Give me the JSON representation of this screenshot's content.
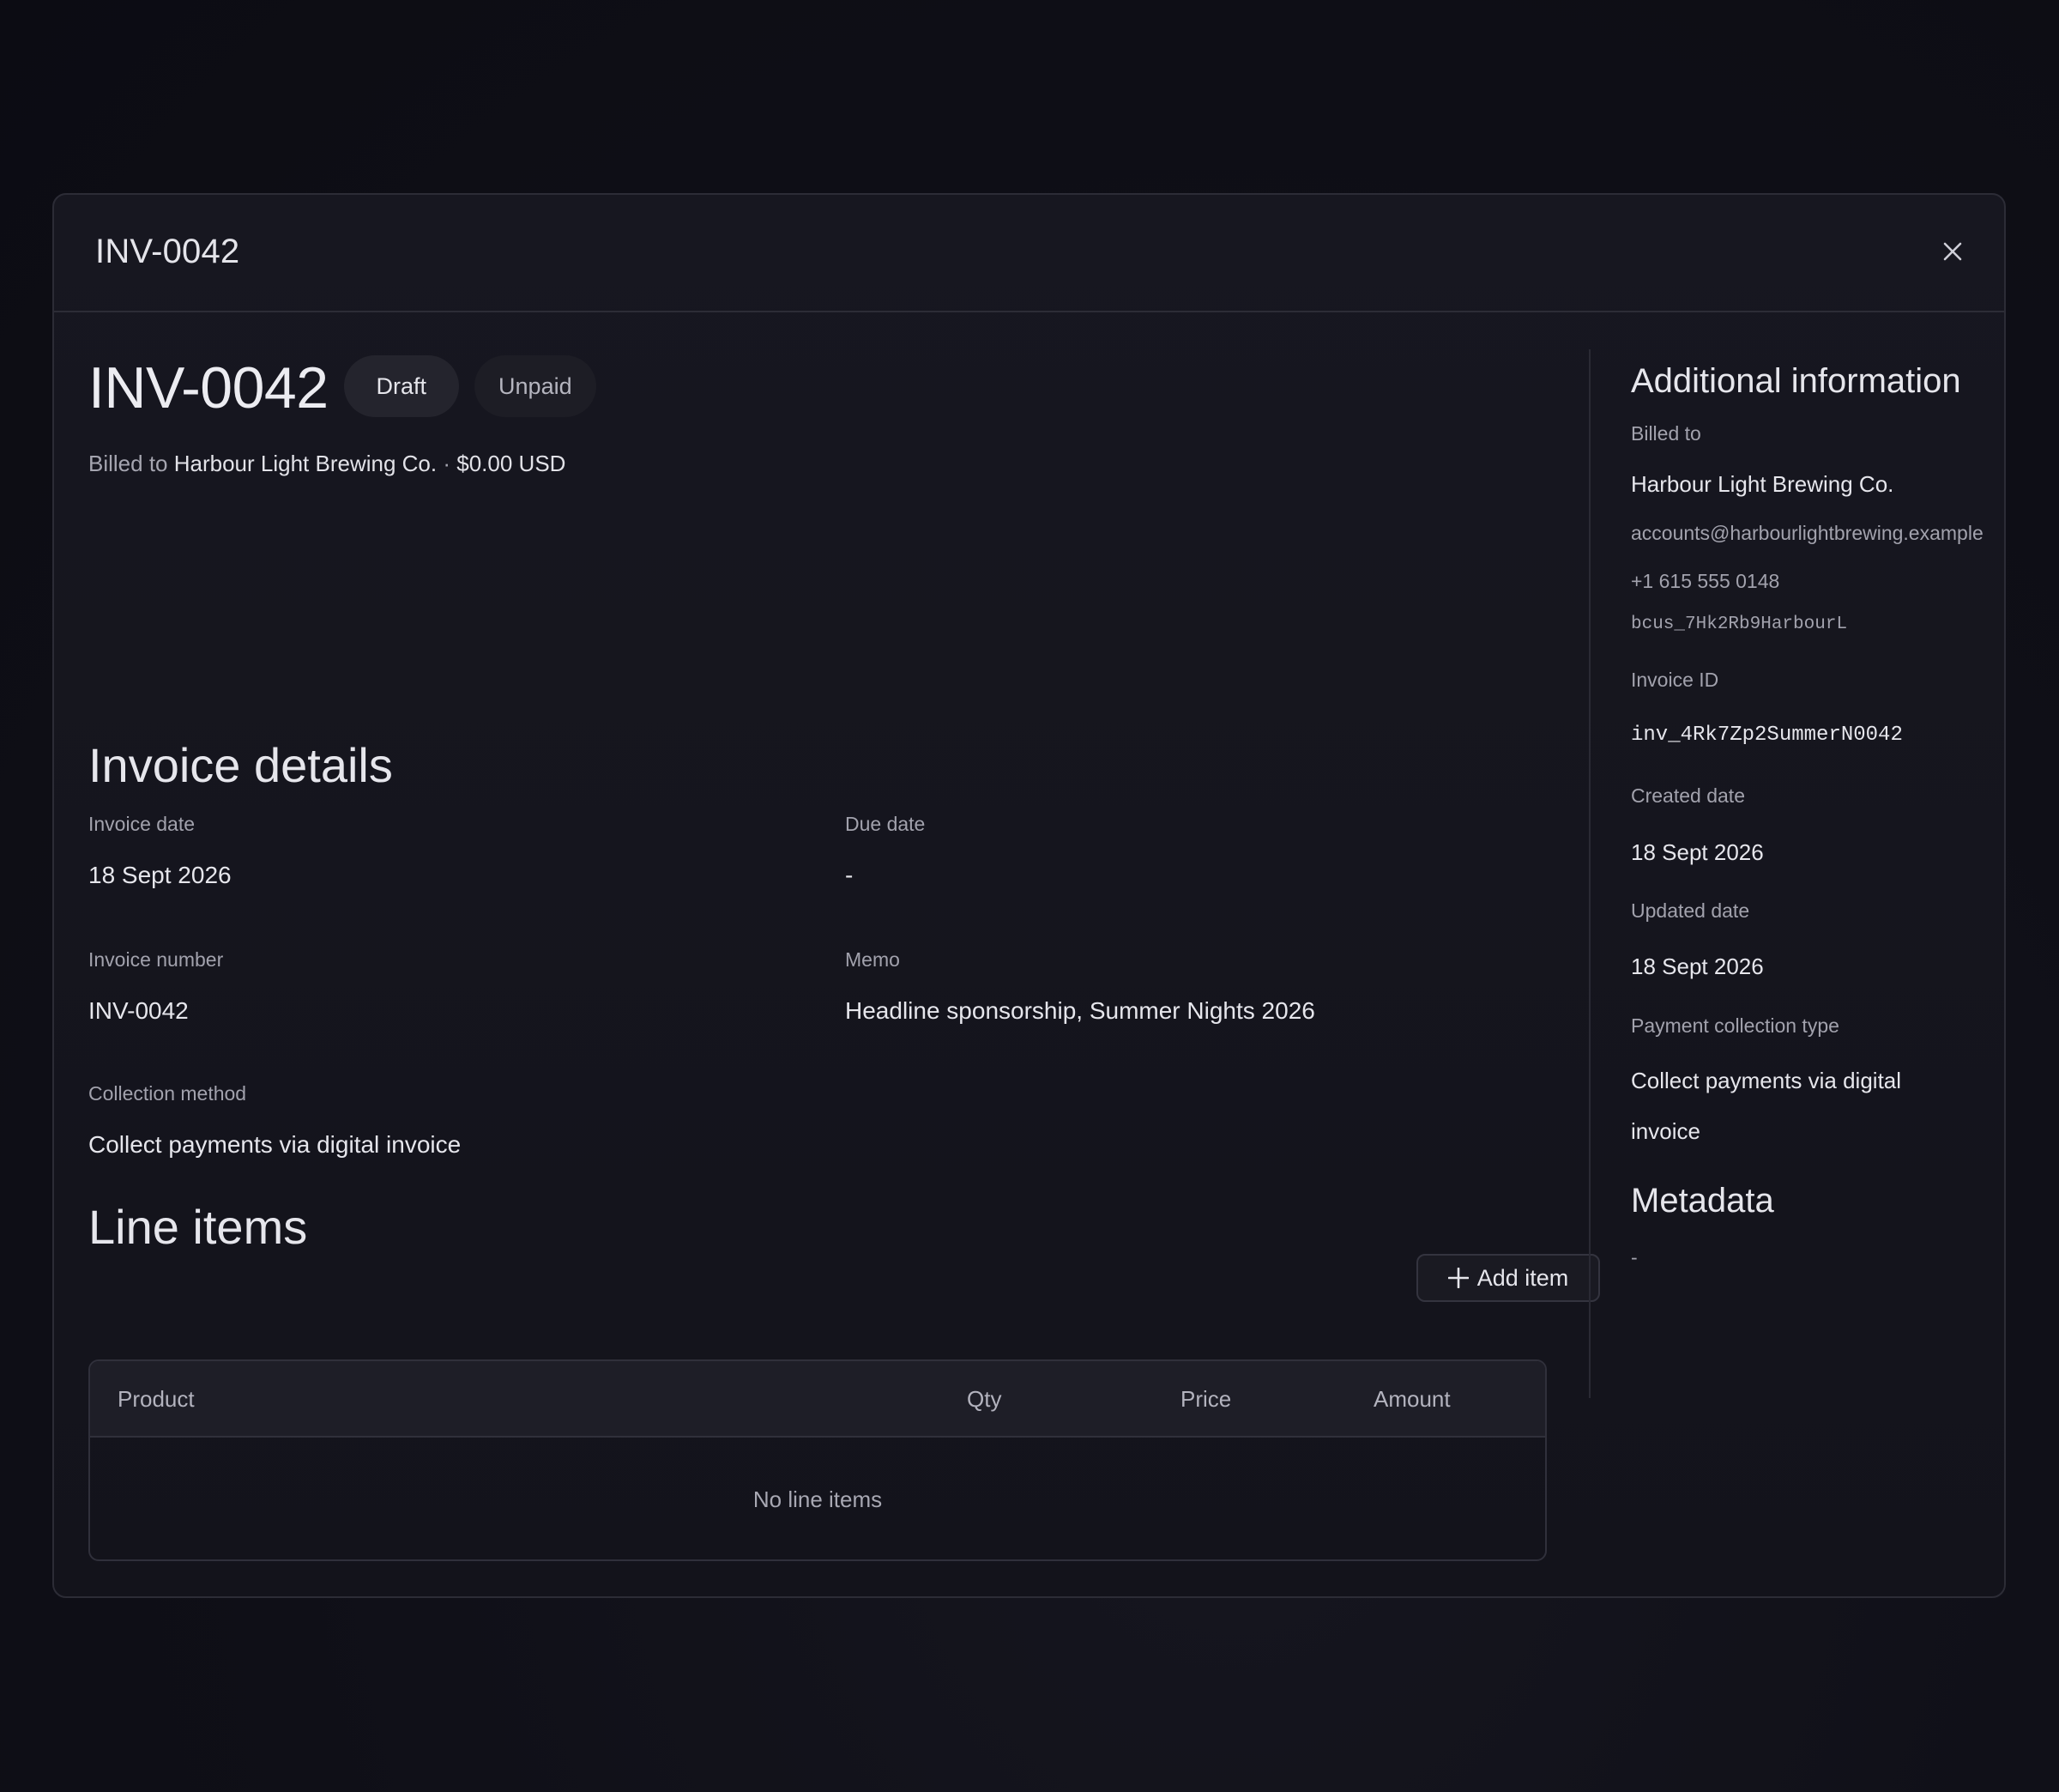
{
  "modal": {
    "title": "INV-0042"
  },
  "invoice": {
    "number": "INV-0042",
    "status_badges": [
      "Draft",
      "Unpaid"
    ],
    "billed_prefix": "Billed to",
    "customer_name": "Harbour Light Brewing Co.",
    "separator": "·",
    "total": "$0.00 USD"
  },
  "details": {
    "title": "Invoice details",
    "invoice_date_label": "Invoice date",
    "invoice_date": "18 Sept 2026",
    "due_date_label": "Due date",
    "due_date": "-",
    "invoice_number_label": "Invoice number",
    "invoice_number": "INV-0042",
    "memo_label": "Memo",
    "memo": "Headline sponsorship, Summer Nights 2026",
    "collection_method_label": "Collection method",
    "collection_method": "Collect payments via digital invoice"
  },
  "line_items": {
    "title": "Line items",
    "add_button_label": "Add item",
    "columns": [
      "Product",
      "Qty",
      "Price",
      "Amount"
    ],
    "empty_text": "No line items"
  },
  "additional": {
    "title": "Additional information",
    "billed_to_label": "Billed to",
    "customer_name": "Harbour Light Brewing Co.",
    "email": "accounts@harbourlightbrewing.example",
    "phone": "+1 615 555 0148",
    "customer_id": "bcus_7Hk2Rb9HarbourL",
    "invoice_id_label": "Invoice ID",
    "invoice_id": "inv_4Rk7Zp2SummerN0042",
    "created_label": "Created date",
    "created": "18 Sept 2026",
    "updated_label": "Updated date",
    "updated": "18 Sept 2026",
    "payment_type_label": "Payment collection type",
    "payment_type_line1": "Collect payments via digital",
    "payment_type_line2": "invoice",
    "metadata_title": "Metadata",
    "metadata_value": "-"
  },
  "icons": {
    "close": "close-icon",
    "plus": "plus-icon"
  }
}
